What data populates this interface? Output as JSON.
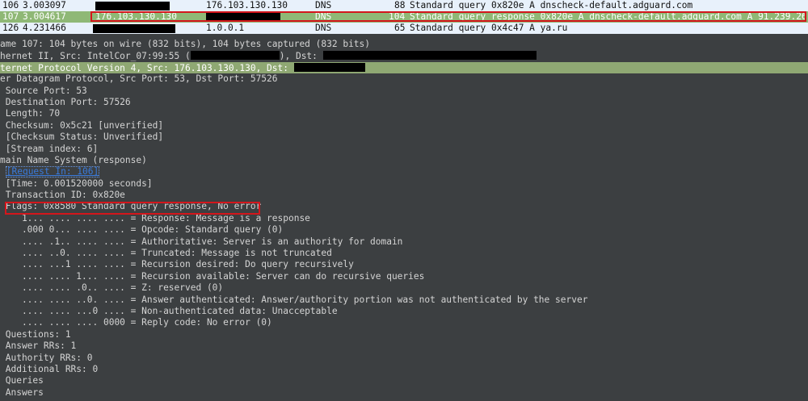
{
  "packets": [
    {
      "no": "106",
      "time": "3.003097",
      "dst": "176.103.130.130",
      "proto": "DNS",
      "len": "88",
      "info": "Standard query 0x820e A dnscheck-default.adguard.com",
      "selected": false
    },
    {
      "no": "107",
      "time": "3.004617",
      "src": "176.103.130.130",
      "proto": "DNS",
      "len": "104",
      "info": "Standard query response 0x820e A dnscheck-default.adguard.com A 91.239.26.97",
      "selected": true
    },
    {
      "no": "126",
      "time": "4.231466",
      "dst": "1.0.0.1",
      "proto": "DNS",
      "len": "65",
      "info": "Standard query 0x4c47 A ya.ru",
      "selected": false
    }
  ],
  "details": {
    "frame": "ame 107: 104 bytes on wire (832 bits), 104 bytes captured (832 bits)",
    "ethernet_prefix": "hernet II, Src: IntelCor_07:99:55 (",
    "ethernet_mid": "), Dst: ",
    "ip": "ternet Protocol Version 4, Src: 176.103.130.130, Dst: ",
    "udp": "er Datagram Protocol, Src Port: 53, Dst Port: 57526",
    "udp_fields": [
      " Source Port: 53",
      " Destination Port: 57526",
      " Length: 70",
      " Checksum: 0x5c21 [unverified]",
      " [Checksum Status: Unverified]",
      " [Stream index: 6]"
    ],
    "dns": "main Name System (response)",
    "request_in": "[Request In: 106]",
    "dns_fields": [
      " [Time: 0.001520000 seconds]",
      " Transaction ID: 0x820e"
    ],
    "flags": " Flags: 0x8580 Standard query response, No error",
    "flag_bits": [
      "    1... .... .... .... = Response: Message is a response",
      "    .000 0... .... .... = Opcode: Standard query (0)",
      "    .... .1.. .... .... = Authoritative: Server is an authority for domain",
      "    .... ..0. .... .... = Truncated: Message is not truncated",
      "    .... ...1 .... .... = Recursion desired: Do query recursively",
      "    .... .... 1... .... = Recursion available: Server can do recursive queries",
      "    .... .... .0.. .... = Z: reserved (0)",
      "    .... .... ..0. .... = Answer authenticated: Answer/authority portion was not authenticated by the server",
      "    .... .... ...0 .... = Non-authenticated data: Unacceptable",
      "    .... .... .... 0000 = Reply code: No error (0)"
    ],
    "counts": [
      " Questions: 1",
      " Answer RRs: 1",
      " Authority RRs: 0",
      " Additional RRs: 0",
      " Queries",
      " Answers"
    ]
  }
}
